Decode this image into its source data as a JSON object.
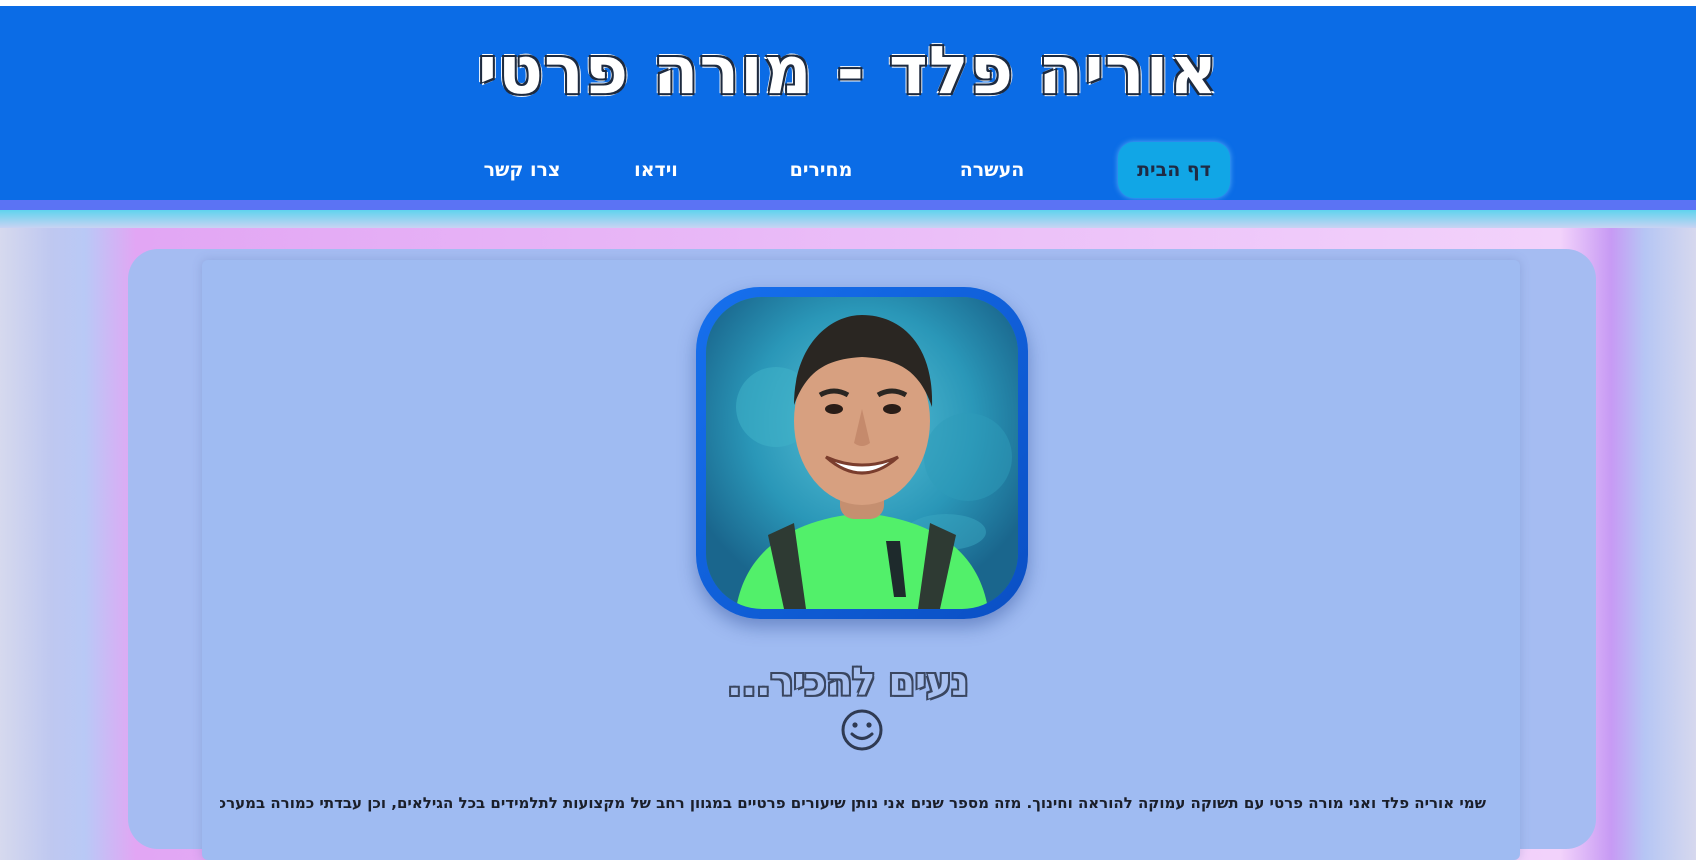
{
  "header": {
    "title": "אוריה פלד - מורה פרטי"
  },
  "nav": {
    "items": [
      {
        "label": "דף הבית",
        "active": true
      },
      {
        "label": "העשרה",
        "active": false
      },
      {
        "label": "מחירים",
        "active": false
      },
      {
        "label": "וידאו",
        "active": false
      },
      {
        "label": "צרו קשר",
        "active": false
      }
    ]
  },
  "main": {
    "profile_photo_alt": "profile-photo",
    "heading": "נעים להכיר...",
    "smiley_icon": "smiley-face-icon",
    "intro": "שמי אוריה פלד ואני מורה פרטי עם תשוקה עמוקה להוראה וחינוך. מזה מספר שנים אני נותן שיעורים פרטיים במגוון רחב של מקצועות לתלמידים בכל הגילאים, וכן עבדתי כמורה במערכת החינוך בבתי"
  },
  "colors": {
    "header_bg": "#0b6ce6",
    "nav_active_bg": "#11a6e6",
    "panel_bg": "#a5bcf2",
    "photo_frame": "#1670ee"
  }
}
